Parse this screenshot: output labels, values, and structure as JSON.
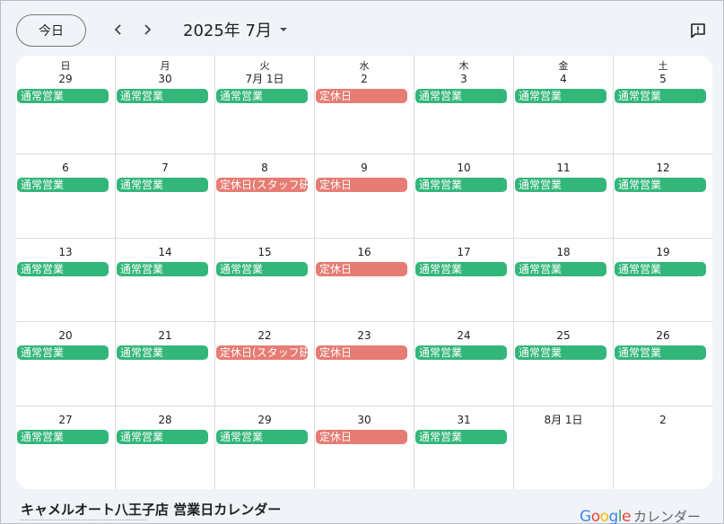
{
  "toolbar": {
    "today_label": "今日",
    "prev_icon": "chevron-left-icon",
    "next_icon": "chevron-right-icon",
    "month_label": "2025年 7月",
    "dropdown_icon": "arrow-drop-down-icon",
    "feedback_icon": "feedback-icon"
  },
  "weekdays": [
    "日",
    "月",
    "火",
    "水",
    "木",
    "金",
    "土"
  ],
  "weeks": [
    [
      {
        "date": "29",
        "event": "通常営業",
        "type": "open"
      },
      {
        "date": "30",
        "event": "通常営業",
        "type": "open"
      },
      {
        "date": "7月 1日",
        "event": "通常営業",
        "type": "open"
      },
      {
        "date": "2",
        "event": "定休日",
        "type": "closed"
      },
      {
        "date": "3",
        "event": "通常営業",
        "type": "open"
      },
      {
        "date": "4",
        "event": "通常営業",
        "type": "open"
      },
      {
        "date": "5",
        "event": "通常営業",
        "type": "open"
      }
    ],
    [
      {
        "date": "6",
        "event": "通常営業",
        "type": "open"
      },
      {
        "date": "7",
        "event": "通常営業",
        "type": "open"
      },
      {
        "date": "8",
        "event": "定休日(スタッフ研修)",
        "type": "closed"
      },
      {
        "date": "9",
        "event": "定休日",
        "type": "closed"
      },
      {
        "date": "10",
        "event": "通常営業",
        "type": "open"
      },
      {
        "date": "11",
        "event": "通常営業",
        "type": "open"
      },
      {
        "date": "12",
        "event": "通常営業",
        "type": "open"
      }
    ],
    [
      {
        "date": "13",
        "event": "通常営業",
        "type": "open"
      },
      {
        "date": "14",
        "event": "通常営業",
        "type": "open"
      },
      {
        "date": "15",
        "event": "通常営業",
        "type": "open"
      },
      {
        "date": "16",
        "event": "定休日",
        "type": "closed"
      },
      {
        "date": "17",
        "event": "通常営業",
        "type": "open"
      },
      {
        "date": "18",
        "event": "通常営業",
        "type": "open"
      },
      {
        "date": "19",
        "event": "通常営業",
        "type": "open"
      }
    ],
    [
      {
        "date": "20",
        "event": "通常営業",
        "type": "open"
      },
      {
        "date": "21",
        "event": "通常営業",
        "type": "open"
      },
      {
        "date": "22",
        "event": "定休日(スタッフ研修)",
        "type": "closed"
      },
      {
        "date": "23",
        "event": "定休日",
        "type": "closed"
      },
      {
        "date": "24",
        "event": "通常営業",
        "type": "open"
      },
      {
        "date": "25",
        "event": "通常営業",
        "type": "open"
      },
      {
        "date": "26",
        "event": "通常営業",
        "type": "open"
      }
    ],
    [
      {
        "date": "27",
        "event": "通常営業",
        "type": "open"
      },
      {
        "date": "28",
        "event": "通常営業",
        "type": "open"
      },
      {
        "date": "29",
        "event": "通常営業",
        "type": "open"
      },
      {
        "date": "30",
        "event": "定休日",
        "type": "closed"
      },
      {
        "date": "31",
        "event": "通常営業",
        "type": "open"
      },
      {
        "date": "8月 1日",
        "event": "",
        "type": ""
      },
      {
        "date": "2",
        "event": "",
        "type": ""
      }
    ]
  ],
  "colors": {
    "open": "#33b679",
    "closed": "#e67c73",
    "background": "#f0f4f9"
  },
  "footer": {
    "calendar_title": "キャメルオート八王子店 営業日カレンダー",
    "google_logo": "Google",
    "product_name": "カレンダー"
  }
}
